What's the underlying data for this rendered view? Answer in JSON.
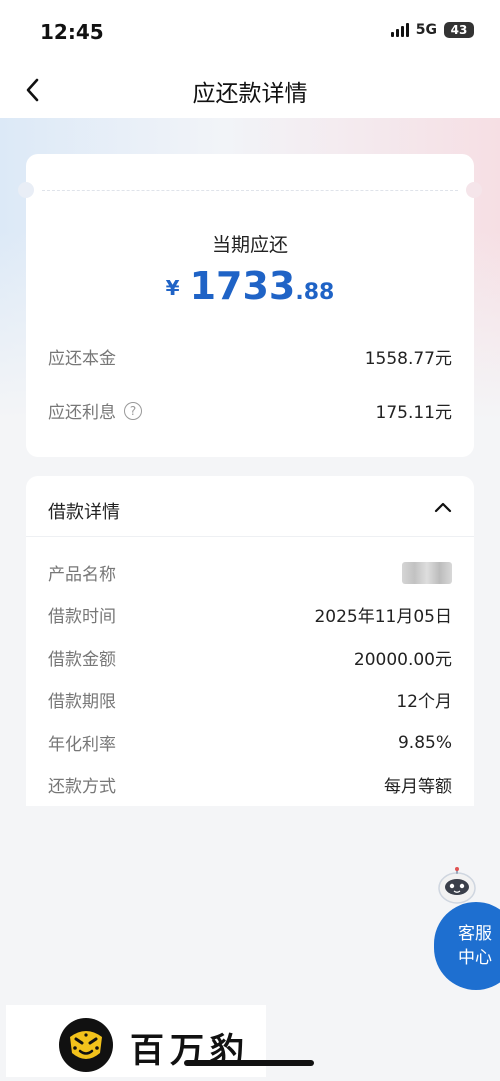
{
  "status": {
    "time": "12:45",
    "network": "5G",
    "battery": "43"
  },
  "nav": {
    "title": "应还款详情"
  },
  "summary": {
    "label": "当期应还",
    "currency": "¥",
    "amount_int": "1733",
    "amount_dec": ".88",
    "principal_label": "应还本金",
    "principal_value": "1558.77元",
    "interest_label": "应还利息",
    "interest_value": "175.11元"
  },
  "loan": {
    "title": "借款详情",
    "rows": [
      {
        "label": "产品名称",
        "value": ""
      },
      {
        "label": "借款时间",
        "value": "2025年11月05日"
      },
      {
        "label": "借款金额",
        "value": "20000.00元"
      },
      {
        "label": "借款期限",
        "value": "12个月"
      },
      {
        "label": "年化利率",
        "value": "9.85%"
      },
      {
        "label": "还款方式",
        "value": "每月等额"
      }
    ]
  },
  "service": {
    "line1": "客服",
    "line2": "中心"
  },
  "brand": {
    "name": "百万豹"
  },
  "icons": {
    "back": "chevron-left-icon",
    "help": "question-circle-icon",
    "collapse": "chevron-up-icon",
    "robot": "robot-mascot-icon",
    "logo": "leopard-logo-icon"
  },
  "colors": {
    "accent": "#1f63c6",
    "service": "#1e6fd0"
  }
}
